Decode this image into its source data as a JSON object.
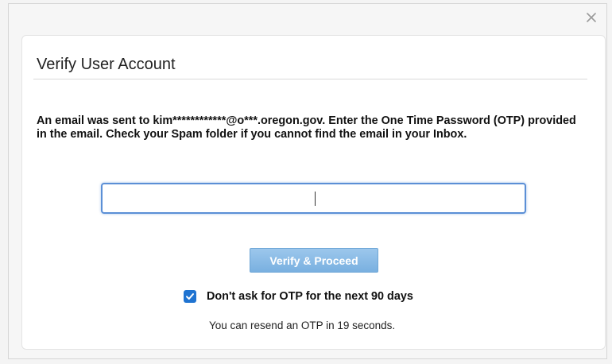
{
  "dialog": {
    "title": "Verify User Account",
    "instructions": "An email was sent to kim************@o***.oregon.gov. Enter the One Time Password (OTP) provided in the email. Check your Spam folder if you cannot find the email in your Inbox.",
    "otp_input": {
      "value": "",
      "placeholder": ""
    },
    "verify_button_label": "Verify & Proceed",
    "remember_checkbox": {
      "label": "Don't ask for OTP for the next 90 days",
      "checked": true
    },
    "resend_text": "You can resend an OTP in 19 seconds."
  },
  "icons": {
    "close": "close-icon",
    "checkmark": "checkmark-icon"
  },
  "colors": {
    "primary_button": "#79b0e0",
    "checkbox": "#1f73d1",
    "input_focus_border": "#5b8fd6"
  }
}
